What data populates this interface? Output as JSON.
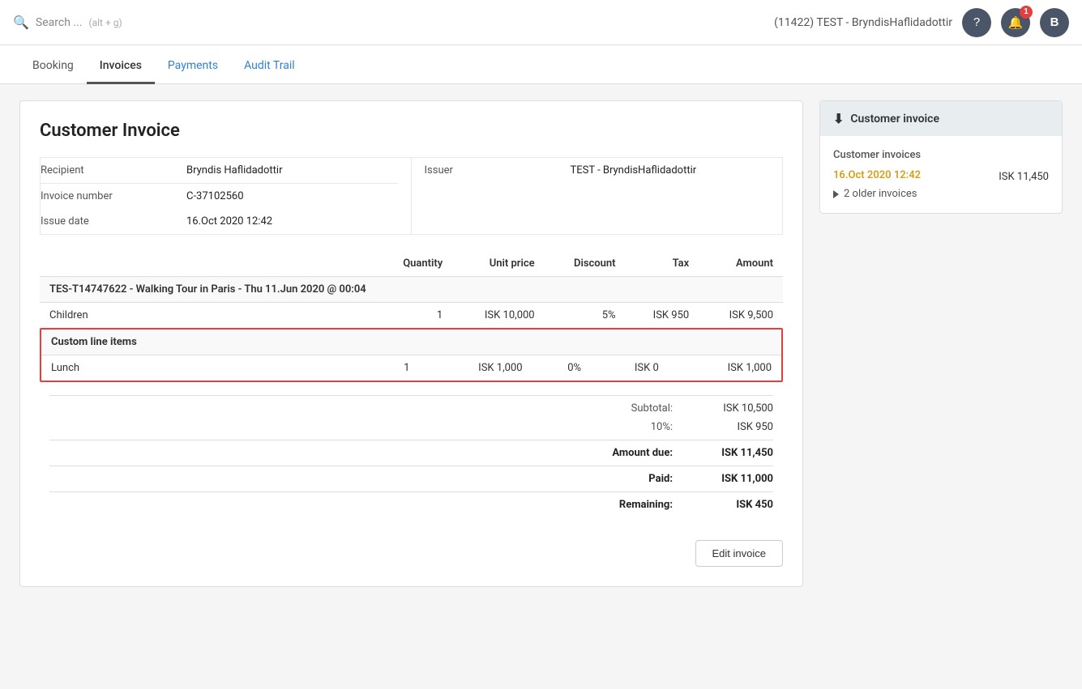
{
  "topbar": {
    "search_placeholder": "Search ...",
    "search_shortcut": "(alt + g)",
    "tenant": "(11422) TEST - BryndisHaflidadottir",
    "help_icon": "?",
    "notif_icon": "🔔",
    "notif_badge": "1",
    "user_icon": "B"
  },
  "tabs": [
    {
      "id": "booking",
      "label": "Booking",
      "active": false,
      "link": false
    },
    {
      "id": "invoices",
      "label": "Invoices",
      "active": true,
      "link": false
    },
    {
      "id": "payments",
      "label": "Payments",
      "active": false,
      "link": true
    },
    {
      "id": "audit-trail",
      "label": "Audit Trail",
      "active": false,
      "link": true
    }
  ],
  "invoice": {
    "title": "Customer Invoice",
    "fields": {
      "recipient_label": "Recipient",
      "recipient_value": "Bryndis Haflidadottir",
      "invoice_number_label": "Invoice number",
      "invoice_number_value": "C-37102560",
      "issue_date_label": "Issue date",
      "issue_date_value": "16.Oct 2020 12:42",
      "issuer_label": "Issuer",
      "issuer_value": "TEST - BryndisHaflidadottir"
    },
    "table_headers": {
      "item": "",
      "quantity": "Quantity",
      "unit_price": "Unit price",
      "discount": "Discount",
      "tax": "Tax",
      "amount": "Amount"
    },
    "tour_row": {
      "label": "TES-T14747622  -  Walking Tour in Paris  -  Thu 11.Jun 2020 @ 00:04"
    },
    "line_items": [
      {
        "name": "Children",
        "quantity": "1",
        "unit_price": "ISK 10,000",
        "discount": "5%",
        "tax": "ISK 950",
        "amount": "ISK 9,500"
      }
    ],
    "custom_section_label": "Custom line items",
    "custom_items": [
      {
        "name": "Lunch",
        "quantity": "1",
        "unit_price": "ISK 1,000",
        "discount": "0%",
        "tax": "ISK 0",
        "amount": "ISK 1,000"
      }
    ],
    "totals": {
      "subtotal_label": "Subtotal:",
      "subtotal_value": "ISK 10,500",
      "tax_label": "10%:",
      "tax_value": "ISK 950",
      "amount_due_label": "Amount due:",
      "amount_due_value": "ISK 11,450",
      "paid_label": "Paid:",
      "paid_value": "ISK 11,000",
      "remaining_label": "Remaining:",
      "remaining_value": "ISK 450"
    },
    "edit_button_label": "Edit invoice"
  },
  "sidebar": {
    "header_label": "Customer invoice",
    "download_icon": "⬇",
    "section_label": "Customer invoices",
    "active_invoice_date": "16.Oct 2020 12:42",
    "active_invoice_amount": "ISK 11,450",
    "older_invoices_label": "2 older invoices"
  }
}
